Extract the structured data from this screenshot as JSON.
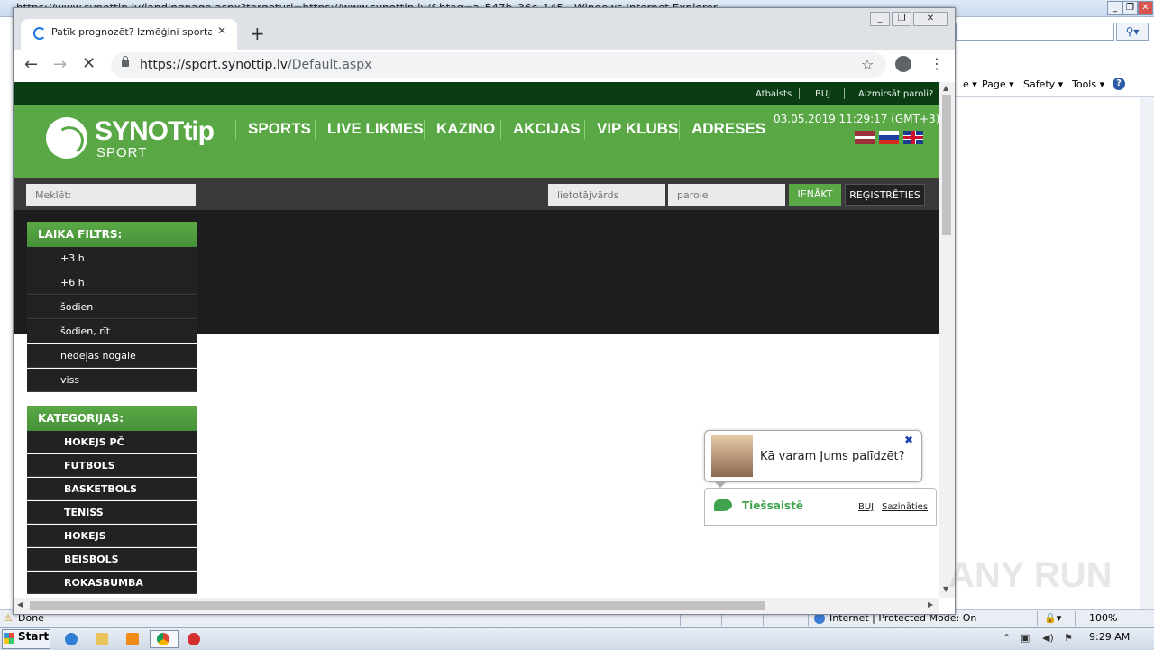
{
  "ie": {
    "title": "https://www.synottip.lv/landingpage.aspx?targeturl=https://www.synottip.lv/&btag=a_547b_36c_145 - Windows Internet Explorer",
    "command_bar": [
      "Page ▾",
      "Safety ▾",
      "Tools ▾"
    ],
    "status_text": "Done",
    "zone_text": "Internet | Protected Mode: On",
    "zoom": "100%"
  },
  "taskbar": {
    "start_label": "Start",
    "clock": "9:29 AM"
  },
  "chrome": {
    "tab_title": "Patīk prognozēt? Izmēģini sporta likmes",
    "url_host": "https://sport.synottip.lv",
    "url_path": "/Default.aspx"
  },
  "site": {
    "top_links": [
      "Atbalsts",
      "BUJ",
      "Aizmirsāt paroli?"
    ],
    "logo_text": "SYNOTtip",
    "logo_sub": "SPORT",
    "nav": [
      "SPORTS",
      "LIVE LIKMES",
      "KAZINO",
      "AKCIJAS",
      "VIP KLUBS",
      "ADRESES"
    ],
    "datetime": "03.05.2019 11:29:17 (GMT+3)",
    "search_placeholder": "Meklēt:",
    "username_placeholder": "lietotājvārds",
    "password_placeholder": "parole",
    "login_label": "IENĀKT",
    "register_label": "REĢISTRĒTIES",
    "time_filter": {
      "title": "LAIKA FILTRS:",
      "items": [
        "+3 h",
        "+6 h",
        "šodien",
        "šodien, rīt",
        "nedēļas nogale",
        "viss"
      ]
    },
    "categories": {
      "title": "KATEGORIJAS:",
      "items": [
        "HOKEJS PČ",
        "FUTBOLS",
        "BASKETBOLS",
        "TENISS",
        "HOKEJS",
        "BEISBOLS",
        "ROKASBUMBA"
      ]
    },
    "chat": {
      "question": "Kā varam Jums palīdzēt?",
      "status": "Tiešsaistē",
      "faq": "BUJ",
      "contact": "Sazināties"
    }
  },
  "watermark": "ANY RUN"
}
